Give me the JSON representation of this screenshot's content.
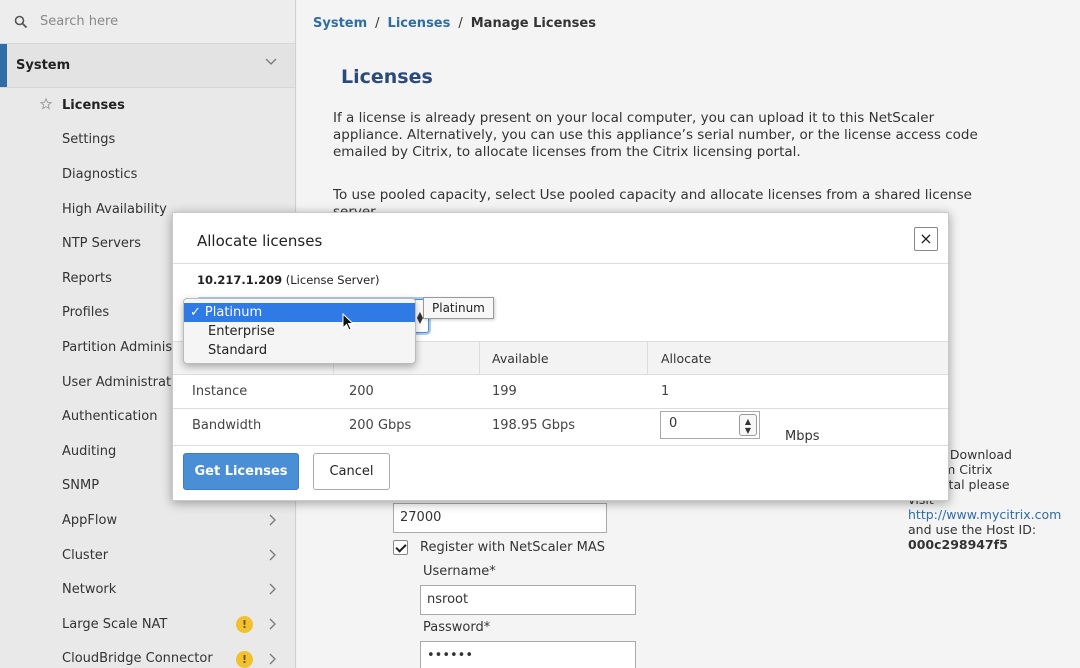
{
  "sidebar": {
    "search_placeholder": "Search here",
    "section": "System",
    "items": [
      {
        "label": "Licenses",
        "active": true
      },
      {
        "label": "Settings"
      },
      {
        "label": "Diagnostics"
      },
      {
        "label": "High Availability"
      },
      {
        "label": "NTP Servers"
      },
      {
        "label": "Reports"
      },
      {
        "label": "Profiles"
      },
      {
        "label": "Partition Administration"
      },
      {
        "label": "User Administration"
      },
      {
        "label": "Authentication"
      },
      {
        "label": "Auditing"
      },
      {
        "label": "SNMP"
      },
      {
        "label": "AppFlow"
      },
      {
        "label": "Cluster"
      },
      {
        "label": "Network"
      },
      {
        "label": "Large Scale NAT"
      },
      {
        "label": "CloudBridge Connector"
      }
    ],
    "warn_glyph": "!"
  },
  "breadcrumb": {
    "system": "System",
    "licenses": "Licenses",
    "current": "Manage Licenses",
    "sep": "/"
  },
  "main": {
    "title": "Licenses",
    "intro": "If a license is already present on your local computer, you can upload it to this NetScaler appliance. Alternatively, you can use this appliance’s serial number, or the license access code emailed by Citrix, to allocate licenses from the Citrix licensing portal.",
    "pooled": "To use pooled capacity, select Use pooled capacity and allocate licenses from a shared license server.",
    "port_value": "27000",
    "register_label": "Register with NetScaler MAS",
    "username_label": "Username*",
    "username_value": "nsroot",
    "password_label": "Password*",
    "password_value": "••••••"
  },
  "help": {
    "line1": "nually Download",
    "line2": "es from Citrix",
    "line3": "ng portal please",
    "line4": "visit",
    "link": "http://www.mycitrix.com",
    "line5": "and use the Host ID:",
    "host_id": "000c298947f5"
  },
  "modal": {
    "title": "Allocate licenses",
    "close": "×",
    "server_ip": "10.217.1.209",
    "server_suffix": "(License Server)",
    "tooltip": "Platinum",
    "columns": [
      "Available",
      "Allocate"
    ],
    "rows": [
      {
        "name": "Instance",
        "total": "200",
        "available": "199",
        "allocate": "1"
      },
      {
        "name": "Bandwidth",
        "total": "200 Gbps",
        "available": "198.95 Gbps",
        "allocate": "0"
      }
    ],
    "unit": "Mbps",
    "get_button": "Get Licenses",
    "cancel_button": "Cancel"
  },
  "dropdown": {
    "options": [
      "Platinum",
      "Enterprise",
      "Standard"
    ],
    "selected": "Platinum",
    "check": "✓"
  },
  "colors": {
    "accent": "#2f6da7",
    "primary_button": "#4a8fd6",
    "selection": "#2f7ae5",
    "warning": "#f2c12e"
  }
}
